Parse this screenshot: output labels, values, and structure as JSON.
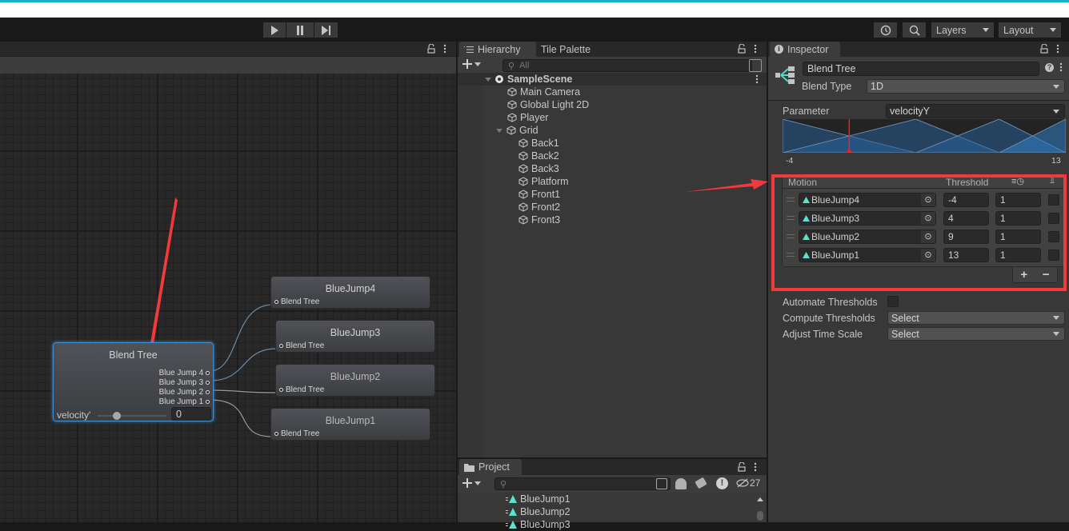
{
  "toolbar": {
    "play_icon": "play-icon",
    "pause_icon": "pause-icon",
    "step_icon": "step-icon",
    "history_icon": "history-icon",
    "search_icon": "search-icon",
    "layers_label": "Layers",
    "layout_label": "Layout"
  },
  "animator": {
    "blend_tree_node": {
      "title": "Blend Tree",
      "outputs": [
        "Blue Jump 4",
        "Blue Jump 3",
        "Blue Jump 2",
        "Blue Jump 1"
      ],
      "param_label": "velocity'",
      "param_value": "0",
      "slider_fraction": 0.25
    },
    "motion_nodes": [
      {
        "title": "BlueJump4",
        "input": "Blend Tree"
      },
      {
        "title": "BlueJump3",
        "input": "Blend Tree"
      },
      {
        "title": "BlueJump2",
        "input": "Blend Tree"
      },
      {
        "title": "BlueJump1",
        "input": "Blend Tree"
      }
    ]
  },
  "hierarchy": {
    "tabs": [
      "Hierarchy",
      "Tile Palette"
    ],
    "search_placeholder": "All",
    "scene": "SampleScene",
    "items": [
      {
        "label": "Main Camera",
        "depth": 1
      },
      {
        "label": "Global Light 2D",
        "depth": 1
      },
      {
        "label": "Player",
        "depth": 1
      },
      {
        "label": "Grid",
        "depth": 1,
        "expanded": true
      },
      {
        "label": "Back1",
        "depth": 2
      },
      {
        "label": "Back2",
        "depth": 2
      },
      {
        "label": "Back3",
        "depth": 2
      },
      {
        "label": "Platform",
        "depth": 2
      },
      {
        "label": "Front1",
        "depth": 2
      },
      {
        "label": "Front2",
        "depth": 2
      },
      {
        "label": "Front3",
        "depth": 2
      }
    ]
  },
  "project": {
    "tab": "Project",
    "search_value": "",
    "hidden_count": "27",
    "items": [
      "BlueJump1",
      "BlueJump2",
      "BlueJump3"
    ]
  },
  "inspector": {
    "tab": "Inspector",
    "name_value": "Blend Tree",
    "blend_type_label": "Blend Type",
    "blend_type_value": "1D",
    "parameter_label": "Parameter",
    "parameter_value": "velocityY",
    "graph_min": "-4",
    "graph_max": "13",
    "current_value": 0,
    "motion_header": "Motion",
    "threshold_header": "Threshold",
    "motions": [
      {
        "name": "BlueJump4",
        "threshold": "-4",
        "speed": "1",
        "mirror": false
      },
      {
        "name": "BlueJump3",
        "threshold": "4",
        "speed": "1",
        "mirror": false
      },
      {
        "name": "BlueJump2",
        "threshold": "9",
        "speed": "1",
        "mirror": false
      },
      {
        "name": "BlueJump1",
        "threshold": "13",
        "speed": "1",
        "mirror": false
      }
    ],
    "add_label": "+",
    "remove_label": "−",
    "automate_label": "Automate Thresholds",
    "automate_checked": false,
    "compute_label": "Compute Thresholds",
    "compute_value": "Select",
    "adjust_label": "Adjust Time Scale",
    "adjust_value": "Select"
  },
  "colors": {
    "accent": "#10b4c0",
    "annotation": "#f23a3a",
    "blend_blue": "#1e5c8c"
  }
}
